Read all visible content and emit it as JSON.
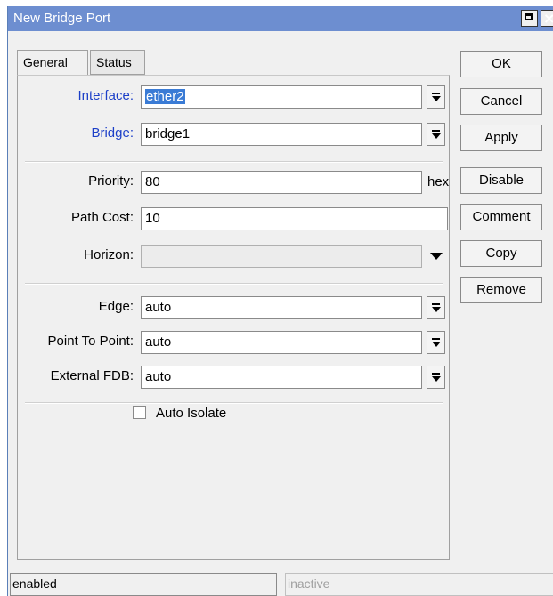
{
  "window": {
    "title": "New Bridge Port"
  },
  "tabs": [
    {
      "label": "General",
      "active": true
    },
    {
      "label": "Status",
      "active": false
    }
  ],
  "form": {
    "interface": {
      "label": "Interface:",
      "value": "ether2"
    },
    "bridge": {
      "label": "Bridge:",
      "value": "bridge1"
    },
    "priority": {
      "label": "Priority:",
      "value": "80",
      "suffix": "hex"
    },
    "path_cost": {
      "label": "Path Cost:",
      "value": "10"
    },
    "horizon": {
      "label": "Horizon:",
      "value": ""
    },
    "edge": {
      "label": "Edge:",
      "value": "auto"
    },
    "point_to_point": {
      "label": "Point To Point:",
      "value": "auto"
    },
    "external_fdb": {
      "label": "External FDB:",
      "value": "auto"
    },
    "auto_isolate": {
      "label": "Auto Isolate",
      "checked": false
    }
  },
  "buttons": {
    "ok": "OK",
    "cancel": "Cancel",
    "apply": "Apply",
    "disable": "Disable",
    "comment": "Comment",
    "copy": "Copy",
    "remove": "Remove"
  },
  "status_bar": {
    "left": "enabled",
    "right": "inactive"
  },
  "colors": {
    "titlebar": "#6d8ed0",
    "link_label": "#1c3fc8",
    "selection": "#3a7bd5"
  }
}
